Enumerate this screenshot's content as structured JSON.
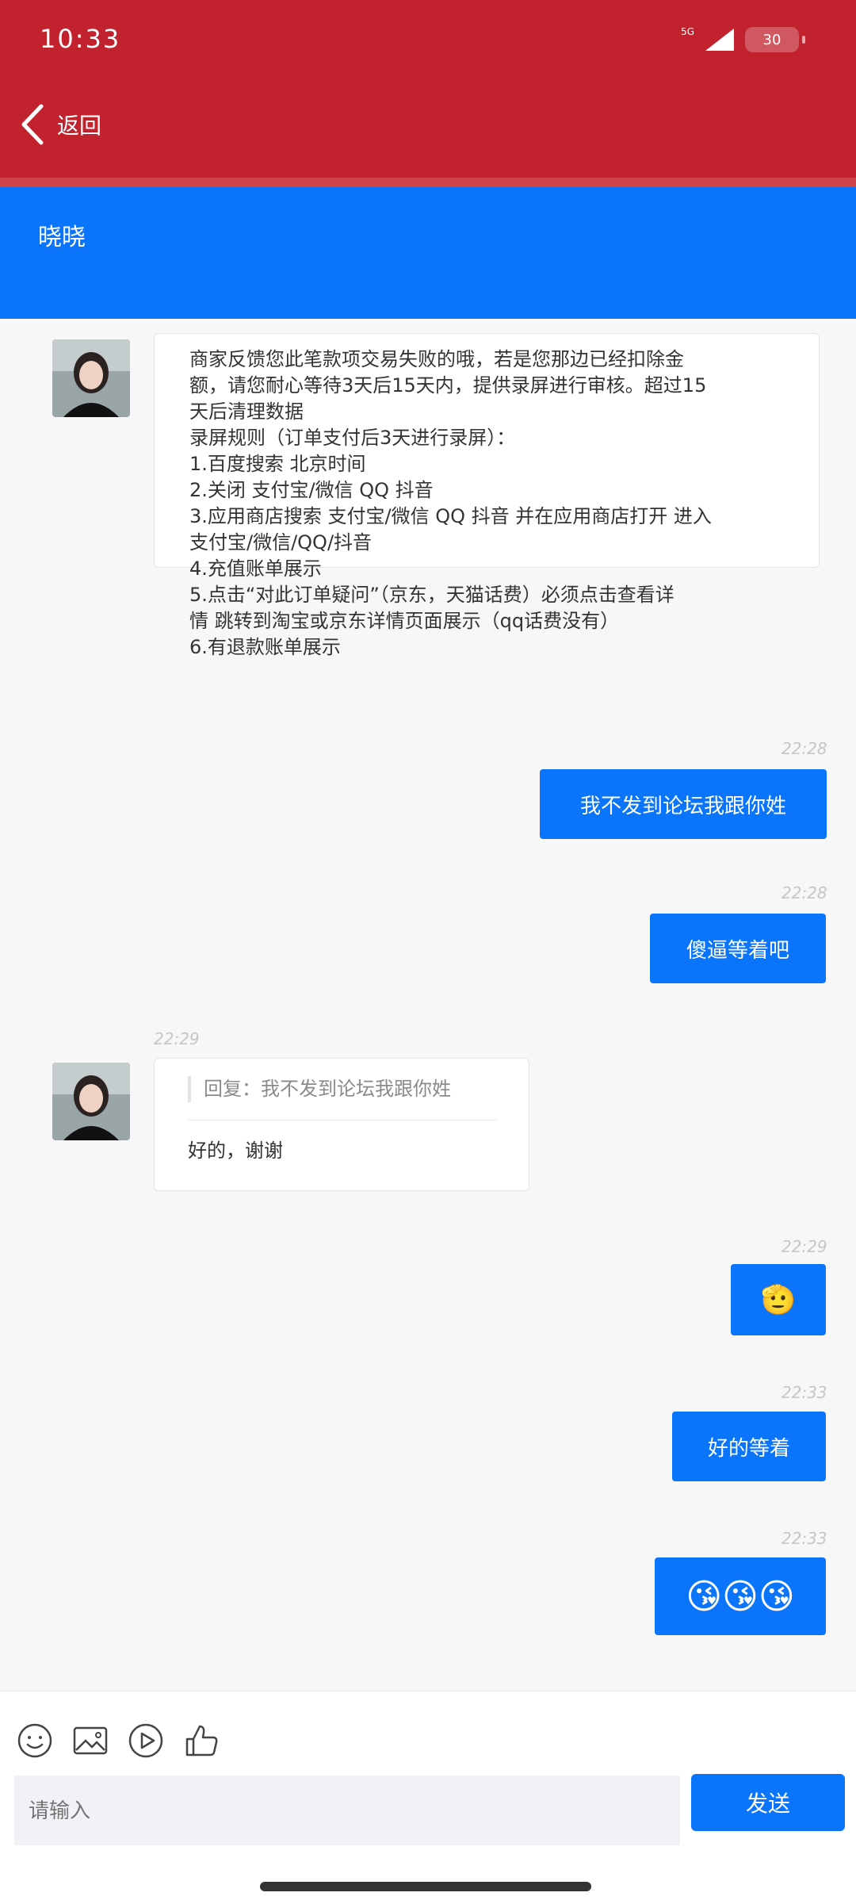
{
  "status_bar": {
    "time": "10:33",
    "network": "5G",
    "battery": "30"
  },
  "nav": {
    "back_label": "返回"
  },
  "header": {
    "contact_name": "晓晓"
  },
  "messages": [
    {
      "side": "left",
      "lines": [
        "商家反馈您此笔款项交易失败的哦，若是您那边已经扣除金",
        "额，请您耐心等待3天后15天内，提供录屏进行审核。超过15",
        "天后清理数据",
        "录屏规则（订单支付后3天进行录屏）：",
        "1.百度搜索 北京时间",
        "2.关闭 支付宝/微信 QQ 抖音",
        "3.应用商店搜索 支付宝/微信 QQ 抖音 并在应用商店打开 进入",
        "支付宝/微信/QQ/抖音",
        "4.充值账单展示",
        "5.点击“对此订单疑问”（京东，天猫话费）必须点击查看详",
        "情 跳转到淘宝或京东详情页面展示（qq话费没有）",
        "6.有退款账单展示"
      ]
    },
    {
      "side": "right",
      "time": "22:28",
      "text": "我不发到论坛我跟你姓"
    },
    {
      "side": "right",
      "time": "22:28",
      "text": "傻逼等着吧"
    },
    {
      "side": "left",
      "time": "22:29",
      "quote": "回复：我不发到论坛我跟你姓",
      "text": "好的，谢谢"
    },
    {
      "side": "right",
      "time": "22:29",
      "text": "🫡"
    },
    {
      "side": "right",
      "time": "22:33",
      "text": "好的等着"
    },
    {
      "side": "right",
      "time": "22:33",
      "text": "😘😘😘"
    }
  ],
  "composer": {
    "placeholder": "请输入",
    "send_label": "发送",
    "tools": [
      "smiley-icon",
      "image-icon",
      "play-icon",
      "thumbs-up-icon"
    ]
  },
  "colors": {
    "status_bar": "#c1222d",
    "header": "#0a74fb",
    "bubble_out": "#0a74fb"
  }
}
